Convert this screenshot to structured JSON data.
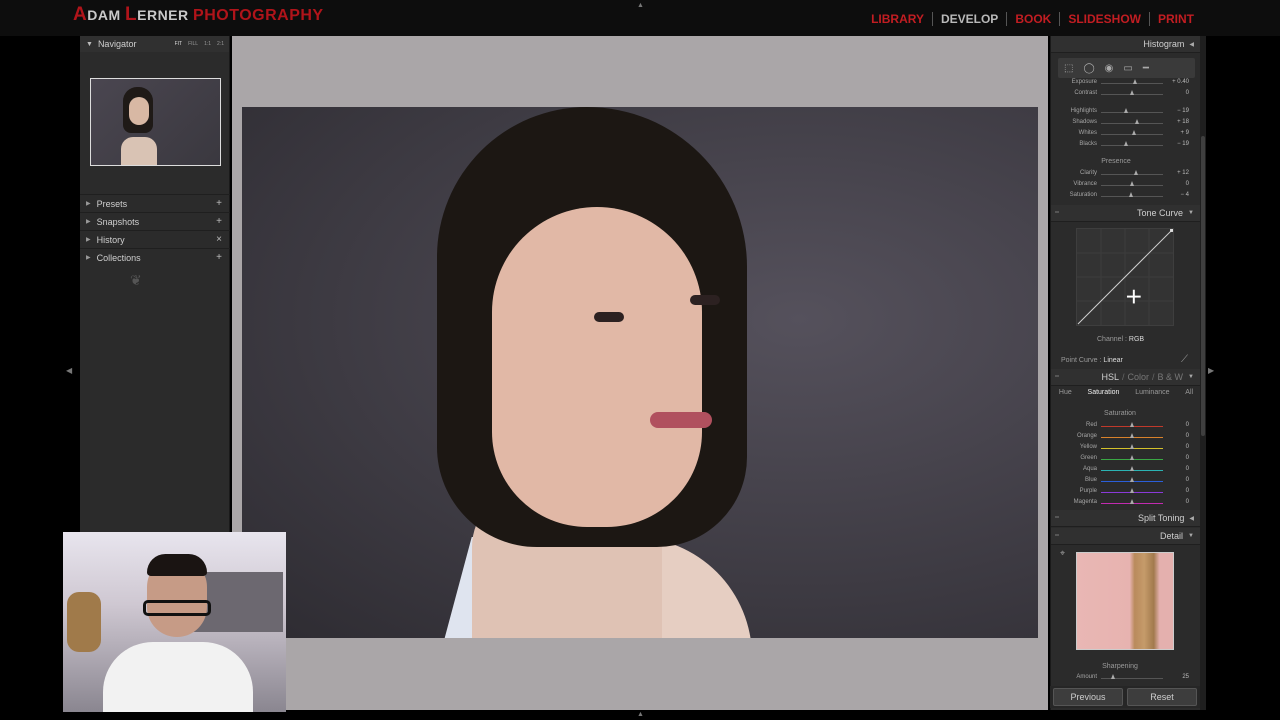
{
  "brand": {
    "first": "A",
    "rest1": "DAM ",
    "l": "L",
    "rest2": "ERNER ",
    "photo": "PHOTOGRAPHY"
  },
  "modules": [
    "LIBRARY",
    "DEVELOP",
    "BOOK",
    "SLIDESHOW",
    "PRINT"
  ],
  "active_module": "DEVELOP",
  "left_panel": {
    "navigator": {
      "title": "Navigator",
      "zooms": [
        "FIT",
        "FILL",
        "1:1",
        "2:1"
      ]
    },
    "sections": [
      {
        "label": "Presets",
        "action": "+"
      },
      {
        "label": "Snapshots",
        "action": "+"
      },
      {
        "label": "History",
        "action": "×"
      },
      {
        "label": "Collections",
        "action": "+"
      }
    ]
  },
  "right_panel": {
    "histogram_title": "Histogram",
    "basic_sliders": [
      {
        "label": "Exposure",
        "value": "+ 0.40",
        "pos": 0.55
      },
      {
        "label": "Contrast",
        "value": "0",
        "pos": 0.5
      },
      {
        "label": "Highlights",
        "value": "− 19",
        "pos": 0.41
      },
      {
        "label": "Shadows",
        "value": "+ 18",
        "pos": 0.58
      },
      {
        "label": "Whites",
        "value": "+ 9",
        "pos": 0.54
      },
      {
        "label": "Blacks",
        "value": "− 19",
        "pos": 0.41
      }
    ],
    "presence_title": "Presence",
    "presence_sliders": [
      {
        "label": "Clarity",
        "value": "+ 12",
        "pos": 0.56
      },
      {
        "label": "Vibrance",
        "value": "0",
        "pos": 0.5
      },
      {
        "label": "Saturation",
        "value": "− 4",
        "pos": 0.48
      }
    ],
    "tone_curve": {
      "title": "Tone Curve",
      "channel_label": "Channel :",
      "channel_value": "RGB",
      "point_curve_label": "Point Curve :",
      "point_curve_value": "Linear"
    },
    "hsl": {
      "title": "HSL",
      "title_color": "Color",
      "title_bw": "B & W",
      "tabs": [
        "Hue",
        "Saturation",
        "Luminance",
        "All"
      ],
      "active_tab": "Saturation",
      "group_title": "Saturation",
      "sliders": [
        {
          "label": "Red",
          "value": "0",
          "color": "#c0392b"
        },
        {
          "label": "Orange",
          "value": "0",
          "color": "#d9822b"
        },
        {
          "label": "Yellow",
          "value": "0",
          "color": "#d4c22b"
        },
        {
          "label": "Green",
          "value": "0",
          "color": "#3aa845"
        },
        {
          "label": "Aqua",
          "value": "0",
          "color": "#2bb3b3"
        },
        {
          "label": "Blue",
          "value": "0",
          "color": "#2b5fd9"
        },
        {
          "label": "Purple",
          "value": "0",
          "color": "#8a3ad9"
        },
        {
          "label": "Magenta",
          "value": "0",
          "color": "#c22bb0"
        }
      ]
    },
    "split_toning_title": "Split Toning",
    "detail": {
      "title": "Detail",
      "sharpening_title": "Sharpening",
      "amount_label": "Amount",
      "amount_value": "25"
    },
    "buttons": {
      "previous": "Previous",
      "reset": "Reset"
    }
  },
  "colors": {
    "accent": "#c21d22",
    "panel": "#2b2b2b",
    "canvas": "#aaa6a8"
  }
}
